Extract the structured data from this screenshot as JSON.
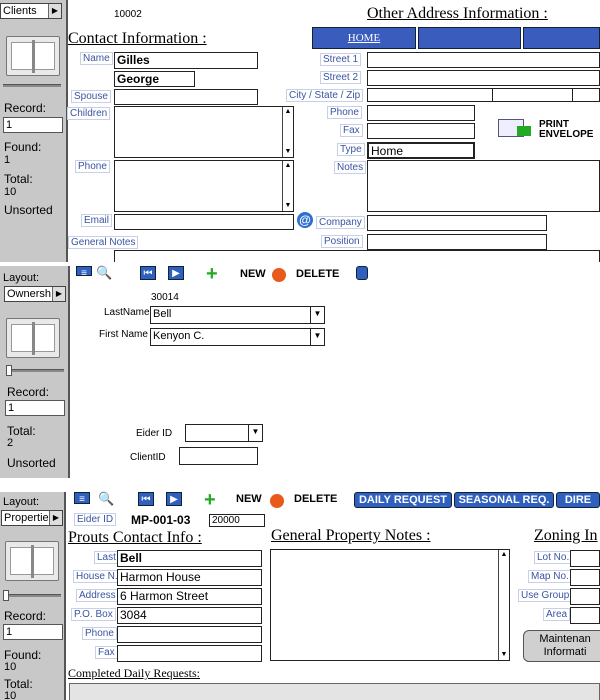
{
  "panel1": {
    "layout_value": "Clients",
    "record_label": "Record:",
    "record_value": "1",
    "found_label": "Found:",
    "found_value": "1",
    "total_label": "Total:",
    "total_value": "10",
    "sort_status": "Unsorted",
    "record_id": "10002",
    "contact_title": "Contact Information :",
    "other_address_title": "Other Address Information :",
    "tabs": [
      "HOME",
      "",
      ""
    ],
    "labels": {
      "name": "Name",
      "spouse": "Spouse",
      "children": "Children",
      "phone": "Phone",
      "email": "Email",
      "general_notes": "General Notes",
      "street1": "Street 1",
      "street2": "Street 2",
      "city_state_zip": "City / State / Zip",
      "phone_right": "Phone",
      "fax": "Fax",
      "type": "Type",
      "notes": "Notes",
      "company": "Company",
      "position": "Position"
    },
    "values": {
      "last_name": "Gilles",
      "first_name": "George",
      "type": "Home"
    },
    "print_envelope": "PRINT ENVELOPE",
    "at_icon": "@"
  },
  "panel2": {
    "layout_label": "Layout:",
    "layout_value": "Ownersh",
    "record_label": "Record:",
    "record_value": "1",
    "total_label": "Total:",
    "total_value": "2",
    "sort_status": "Unsorted",
    "toolbar_new": "NEW",
    "toolbar_delete": "DELETE",
    "record_id": "30014",
    "lastname_label": "LastName",
    "lastname_value": "Bell",
    "firstname_label": "First Name",
    "firstname_value": "Kenyon C.",
    "eider_label": "Eider ID",
    "clientid_label": "ClientID"
  },
  "panel3": {
    "layout_label": "Layout:",
    "layout_value": "Propertie",
    "record_label": "Record:",
    "record_value": "1",
    "found_label": "Found:",
    "found_value": "10",
    "total_label": "Total:",
    "total_value": "10",
    "toolbar_new": "NEW",
    "toolbar_delete": "DELETE",
    "btn_daily": "DAILY REQUEST",
    "btn_seasonal": "SEASONAL REQ.",
    "btn_dire": "DIRE",
    "eider_label": "Eider ID",
    "eider_value": "MP-001-03",
    "id_value": "20000",
    "prouts_title": "Prouts Contact Info :",
    "notes_title": "General Property Notes :",
    "zoning_title": "Zoning In",
    "labels": {
      "last": "Last",
      "house": "House N.",
      "address": "Address",
      "pobox": "P.O. Box",
      "phone": "Phone",
      "fax": "Fax",
      "lotno": "Lot No.",
      "mapno": "Map No.",
      "usegroup": "Use Group",
      "area": "Area"
    },
    "values": {
      "last": "Bell",
      "house": "Harmon House",
      "address": "6 Harmon Street",
      "pobox": "3084"
    },
    "maint_btn_1": "Maintenan",
    "maint_btn_2": "Informati",
    "completed_title": "Completed Daily Requests:"
  },
  "colors": {
    "panel_gray": "#c8c8c8",
    "tab_blue": "#3a5dbd",
    "label_blue": "#3a55a0"
  }
}
